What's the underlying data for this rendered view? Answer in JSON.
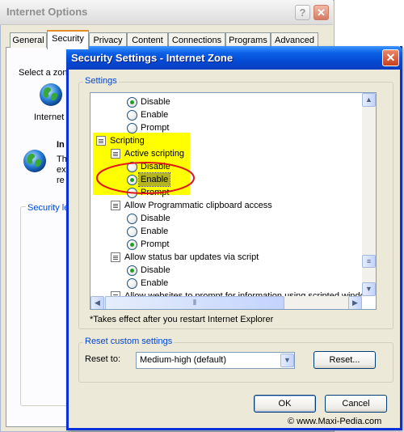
{
  "background_window": {
    "title": "Internet Options",
    "help_button": "?",
    "close_button": "✕",
    "tabs": [
      {
        "label": "General"
      },
      {
        "label": "Security"
      },
      {
        "label": "Privacy"
      },
      {
        "label": "Content"
      },
      {
        "label": "Connections"
      },
      {
        "label": "Programs"
      },
      {
        "label": "Advanced"
      }
    ],
    "active_tab": "Security",
    "zone_prompt": "Select a zon",
    "zone_label": "Internet",
    "zone_title": "In",
    "zone_desc": [
      "Th",
      "ex",
      "re"
    ],
    "security_level_label": "Security le"
  },
  "dialog": {
    "title": "Security Settings - Internet Zone",
    "close_button": "✕",
    "settings_label": "Settings",
    "items": [
      {
        "type": "radio",
        "label": "Disable",
        "checked": true
      },
      {
        "type": "radio",
        "label": "Enable",
        "checked": false
      },
      {
        "type": "radio",
        "label": "Prompt",
        "checked": false
      },
      {
        "type": "category",
        "label": "Scripting"
      },
      {
        "type": "setting",
        "label": "Active scripting"
      },
      {
        "type": "radio",
        "label": "Disable",
        "checked": false
      },
      {
        "type": "radio",
        "label": "Enable",
        "checked": true
      },
      {
        "type": "radio",
        "label": "Prompt",
        "checked": false
      },
      {
        "type": "setting",
        "label": "Allow Programmatic clipboard access"
      },
      {
        "type": "radio",
        "label": "Disable",
        "checked": false
      },
      {
        "type": "radio",
        "label": "Enable",
        "checked": false
      },
      {
        "type": "radio",
        "label": "Prompt",
        "checked": true
      },
      {
        "type": "setting",
        "label": "Allow status bar updates via script"
      },
      {
        "type": "radio",
        "label": "Disable",
        "checked": true
      },
      {
        "type": "radio",
        "label": "Enable",
        "checked": false
      },
      {
        "type": "setting",
        "label": "Allow websites to prompt for information using scripted windo"
      }
    ],
    "restart_note": "*Takes effect after you restart Internet Explorer",
    "reset_group_label": "Reset custom settings",
    "reset_to_label": "Reset to:",
    "reset_to_value": "Medium-high (default)",
    "reset_button": "Reset...",
    "ok_button": "OK",
    "cancel_button": "Cancel"
  },
  "watermark": "© www.Maxi-Pedia.com",
  "colors": {
    "title_bar": "#0a5fe6",
    "highlight": "#ffff00",
    "annotation_circle": "#e0161a",
    "radio_checked": "#21a121",
    "group_label": "#0046d5"
  },
  "icons": [
    "globe-icon",
    "scroll-icon",
    "radio-icon",
    "close-icon",
    "help-icon",
    "arrow-up-icon",
    "arrow-down-icon",
    "arrow-left-icon",
    "arrow-right-icon",
    "chevron-down-icon"
  ]
}
